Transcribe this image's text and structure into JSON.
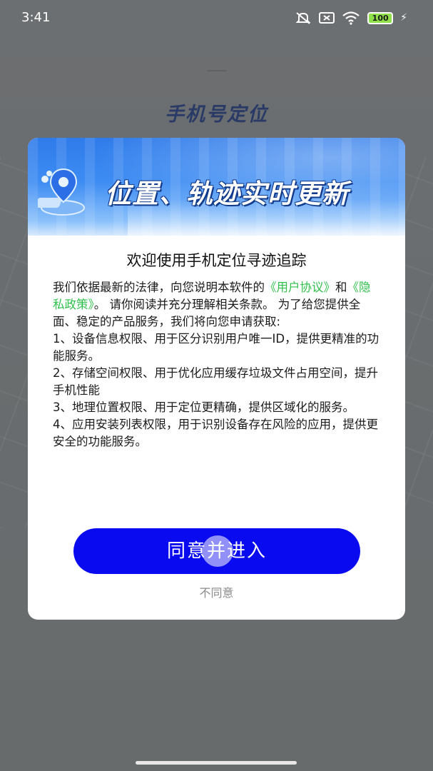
{
  "status_bar": {
    "time": "3:41",
    "battery": "100",
    "icons": [
      "mute-icon",
      "sim-off-icon",
      "wifi-icon",
      "battery-icon",
      "charging-icon"
    ]
  },
  "background": {
    "title": "手机号定位"
  },
  "dialog": {
    "banner_text": "位置、轨迹实时更新",
    "title": "欢迎使用手机定位寻迹追踪",
    "intro_prefix": "我们依据最新的法律，向您说明本软件的",
    "user_agreement_link": "《用户协议》",
    "intro_and": "和",
    "privacy_link": "《隐私政策》",
    "intro_suffix": "。 请你阅读并充分理解相关条款。 为了给您提供全面、稳定的产品服务，我们将向您申请获取:",
    "items": [
      "1、设备信息权限、用于区分识别用户唯一ID，提供更精准的功能服务。",
      "2、存储空间权限、用于优化应用缓存垃圾文件占用空间，提升手机性能",
      "3、地理位置权限、用于定位更精确，提供区域化的服务。",
      "4、应用安装列表权限，用于识别设备存在风险的应用，提供更安全的功能服务。"
    ],
    "agree_label": "同意并进入",
    "disagree_label": "不同意"
  },
  "colors": {
    "agree_button": "#0a0af0",
    "link": "#2fbf4b",
    "banner": "#3d8cf3"
  }
}
